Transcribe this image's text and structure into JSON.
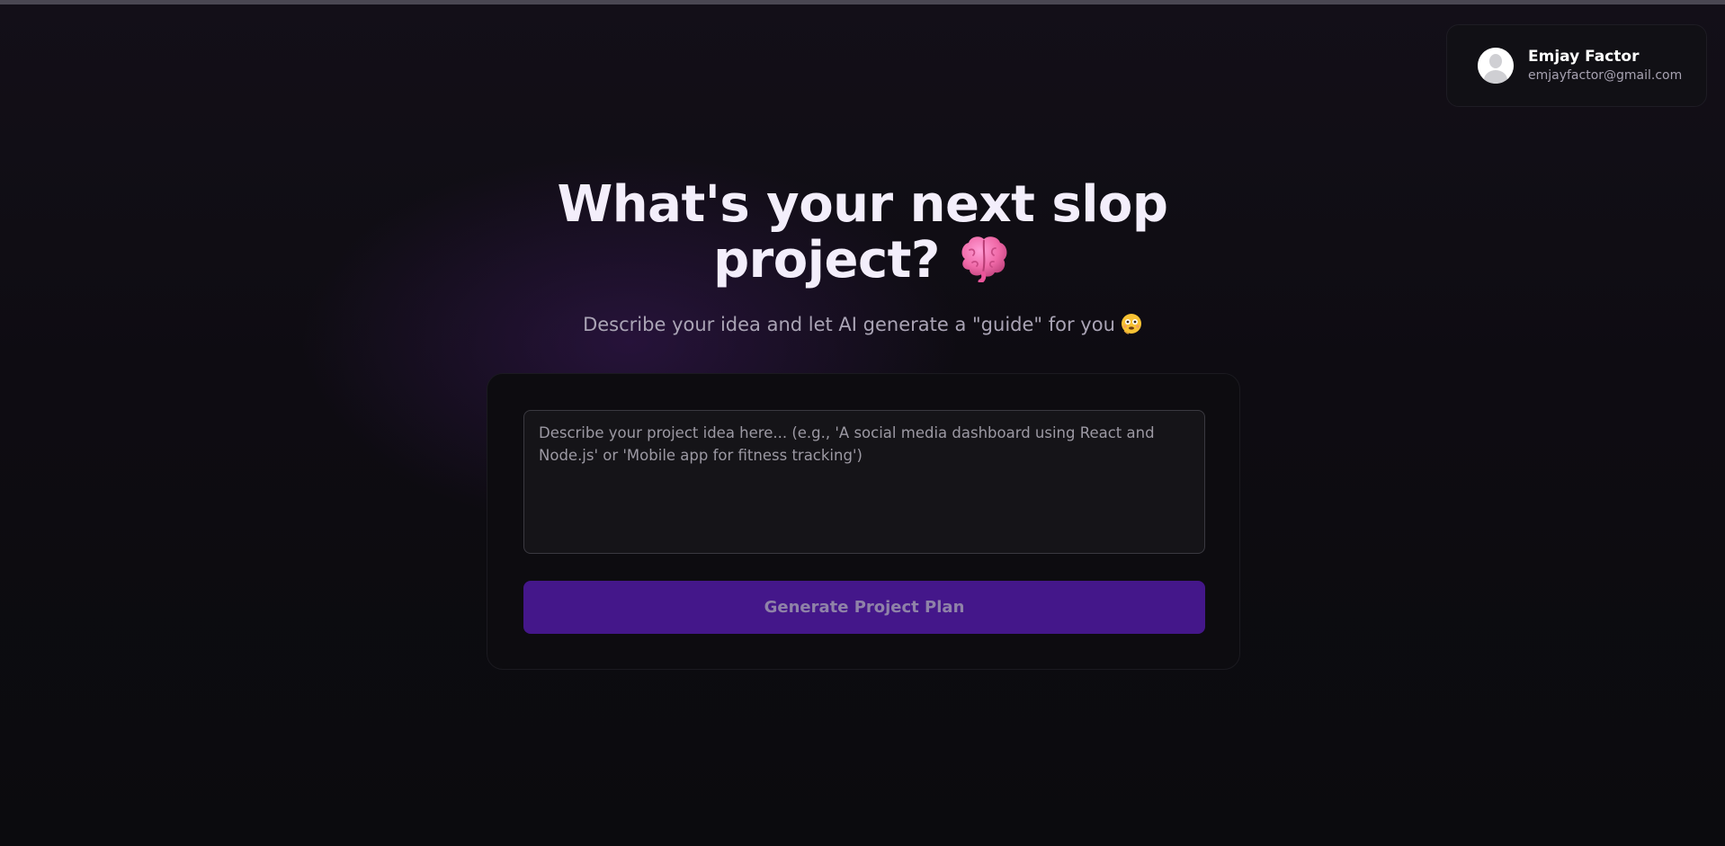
{
  "user": {
    "name": "Emjay Factor",
    "email": "emjayfactor@gmail.com"
  },
  "hero": {
    "title": "What's your next slop project?",
    "title_icon": "brain-icon",
    "subtitle": "Describe your idea and let AI generate a \"guide\" for you",
    "subtitle_icon": "flushed-face-icon"
  },
  "form": {
    "input_placeholder": "Describe your project idea here... (e.g., 'A social media dashboard using React and Node.js' or 'Mobile app for fitness tracking')",
    "input_value": "",
    "button_label": "Generate Project Plan"
  },
  "colors": {
    "background": "#0e0c12",
    "accent": "#44178a",
    "card": "#111015"
  }
}
